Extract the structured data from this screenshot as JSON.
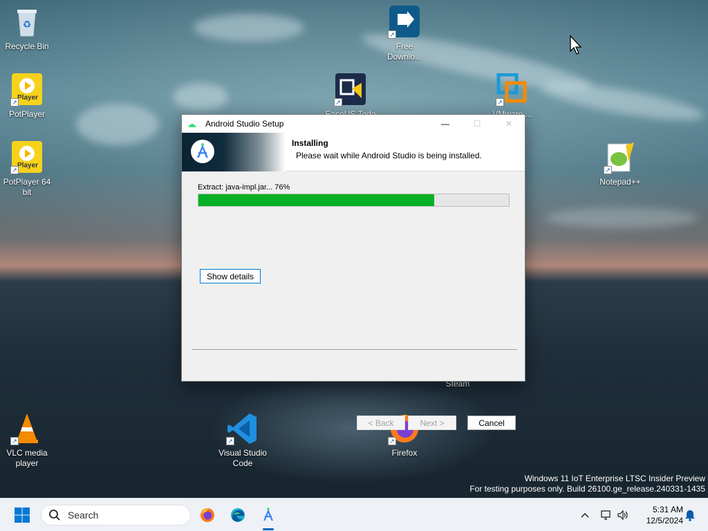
{
  "desktop": {
    "icons": [
      {
        "name": "Recycle Bin",
        "label": "Recycle Bin"
      },
      {
        "name": "PotPlayer",
        "label": "PotPlayer"
      },
      {
        "name": "PotPlayer 64 bit",
        "label": "PotPlayer 64 bit"
      },
      {
        "name": "Free Download",
        "label": "Free Downlo..."
      },
      {
        "name": "EaseUS Todo",
        "label": "EaseUS Todo ..."
      },
      {
        "name": "VMware",
        "label": "VMware ..."
      },
      {
        "name": "Notepad++",
        "label": "Notepad++"
      },
      {
        "name": "Steam",
        "label": "Steam"
      },
      {
        "name": "VLC media player",
        "label": "VLC media player"
      },
      {
        "name": "Visual Studio Code",
        "label": "Visual Studio Code"
      },
      {
        "name": "Firefox",
        "label": "Firefox"
      }
    ],
    "potplayer_badge": "Player",
    "watermark": {
      "line1": "Windows 11 IoT Enterprise LTSC Insider Preview",
      "line2": "For testing purposes only. Build 26100.ge_release.240331-1435"
    }
  },
  "dialog": {
    "title": "Android Studio Setup",
    "header_title": "Installing",
    "header_subtitle": "Please wait while Android Studio is being installed.",
    "status_text": "Extract: java-impl.jar... 76%",
    "progress": 0.76,
    "show_details_label": "Show details",
    "back_label": "< Back",
    "next_label": "Next >",
    "cancel_label": "Cancel",
    "window_controls": {
      "minimize": "—",
      "maximize": "☐",
      "close": "✕"
    }
  },
  "taskbar": {
    "search_placeholder": "Search",
    "clock_time": "5:31 AM",
    "clock_date": "12/5/2024",
    "accent": "#0067c0"
  }
}
